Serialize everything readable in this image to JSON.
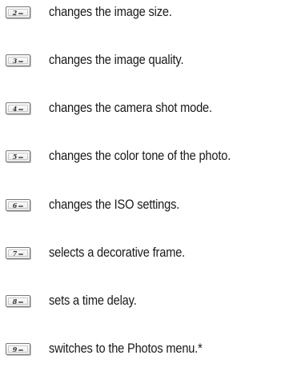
{
  "rows": [
    {
      "key": "2",
      "text": "changes the image size."
    },
    {
      "key": "3",
      "text": "changes the image quality."
    },
    {
      "key": "4",
      "text": "changes the camera shot mode."
    },
    {
      "key": "5",
      "text": "changes the color tone of the photo."
    },
    {
      "key": "6",
      "text": "changes the ISO settings."
    },
    {
      "key": "7",
      "text": "selects a decorative frame."
    },
    {
      "key": "8",
      "text": "sets a time delay."
    },
    {
      "key": "9",
      "text": "switches to the Photos menu.*"
    }
  ]
}
